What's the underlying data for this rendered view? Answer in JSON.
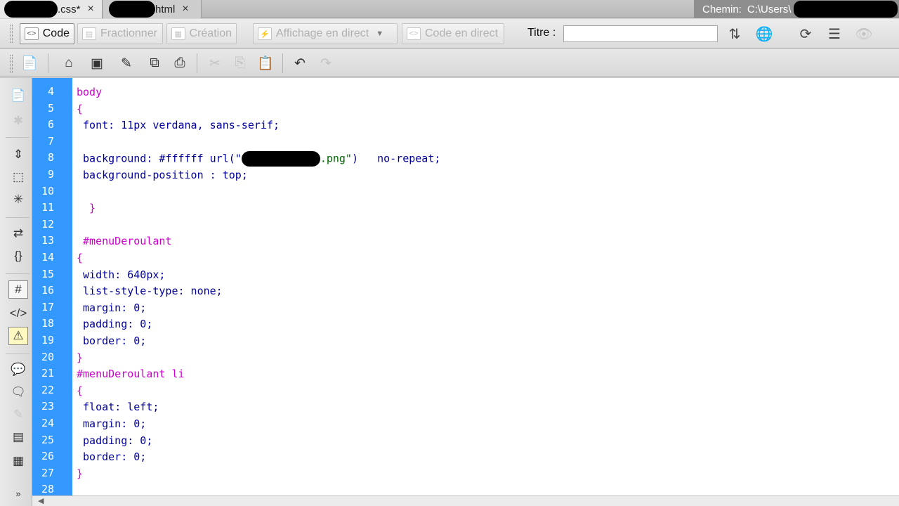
{
  "tabs": [
    {
      "label": ".css*",
      "close": "×"
    },
    {
      "label": "html",
      "close": "×"
    }
  ],
  "path": {
    "label": "Chemin:",
    "value": "C:\\Users\\"
  },
  "toolbar": {
    "code": "Code",
    "split": "Fractionner",
    "design": "Création",
    "live_view": "Affichage en direct",
    "live_code": "Code en direct",
    "title_label": "Titre :",
    "title_value": ""
  },
  "editor": {
    "lines": [
      {
        "n": "4",
        "parts": [
          {
            "t": "body",
            "c": "sel"
          }
        ]
      },
      {
        "n": "5",
        "parts": [
          {
            "t": "{",
            "c": "sel"
          }
        ]
      },
      {
        "n": "6",
        "parts": [
          {
            "t": " font",
            "c": "prop"
          },
          {
            "t": ": 11px verdana, sans-serif;",
            "c": "val"
          }
        ]
      },
      {
        "n": "7",
        "parts": []
      },
      {
        "n": "8",
        "parts": [
          {
            "t": " background",
            "c": "prop"
          },
          {
            "t": ": #ffffff url(\"",
            "c": "val"
          },
          {
            "t": "REDACT",
            "c": "redact"
          },
          {
            "t": ".png\"",
            "c": "str"
          },
          {
            "t": ")   no-repeat;",
            "c": "val"
          }
        ]
      },
      {
        "n": "9",
        "parts": [
          {
            "t": " background-position",
            "c": "prop"
          },
          {
            "t": " : top;",
            "c": "val"
          }
        ]
      },
      {
        "n": "10",
        "parts": []
      },
      {
        "n": "11",
        "parts": [
          {
            "t": "  }",
            "c": "sel"
          }
        ]
      },
      {
        "n": "12",
        "parts": []
      },
      {
        "n": "13",
        "parts": [
          {
            "t": " #menuDeroulant",
            "c": "sel"
          }
        ]
      },
      {
        "n": "14",
        "parts": [
          {
            "t": "{",
            "c": "sel"
          }
        ]
      },
      {
        "n": "15",
        "parts": [
          {
            "t": " width",
            "c": "prop"
          },
          {
            "t": ": 640px;",
            "c": "val"
          }
        ]
      },
      {
        "n": "16",
        "parts": [
          {
            "t": " list-style-type",
            "c": "prop"
          },
          {
            "t": ": none;",
            "c": "val"
          }
        ]
      },
      {
        "n": "17",
        "parts": [
          {
            "t": " margin",
            "c": "prop"
          },
          {
            "t": ": 0;",
            "c": "val"
          }
        ]
      },
      {
        "n": "18",
        "parts": [
          {
            "t": " padding",
            "c": "prop"
          },
          {
            "t": ": 0;",
            "c": "val"
          }
        ]
      },
      {
        "n": "19",
        "parts": [
          {
            "t": " border",
            "c": "prop"
          },
          {
            "t": ": 0;",
            "c": "val"
          }
        ]
      },
      {
        "n": "20",
        "parts": [
          {
            "t": "}",
            "c": "sel"
          }
        ]
      },
      {
        "n": "21",
        "parts": [
          {
            "t": "#menuDeroulant li",
            "c": "sel"
          }
        ]
      },
      {
        "n": "22",
        "parts": [
          {
            "t": "{",
            "c": "sel"
          }
        ]
      },
      {
        "n": "23",
        "parts": [
          {
            "t": " float",
            "c": "prop"
          },
          {
            "t": ": left;",
            "c": "val"
          }
        ]
      },
      {
        "n": "24",
        "parts": [
          {
            "t": " margin",
            "c": "prop"
          },
          {
            "t": ": 0;",
            "c": "val"
          }
        ]
      },
      {
        "n": "25",
        "parts": [
          {
            "t": " padding",
            "c": "prop"
          },
          {
            "t": ": 0;",
            "c": "val"
          }
        ]
      },
      {
        "n": "26",
        "parts": [
          {
            "t": " border",
            "c": "prop"
          },
          {
            "t": ": 0;",
            "c": "val"
          }
        ]
      },
      {
        "n": "27",
        "parts": [
          {
            "t": "}",
            "c": "sel"
          }
        ]
      },
      {
        "n": "28",
        "parts": []
      }
    ]
  },
  "colors": {
    "gutter": "#3399ff",
    "selector": "#cc00cc",
    "property": "#000099",
    "string": "#006600"
  }
}
